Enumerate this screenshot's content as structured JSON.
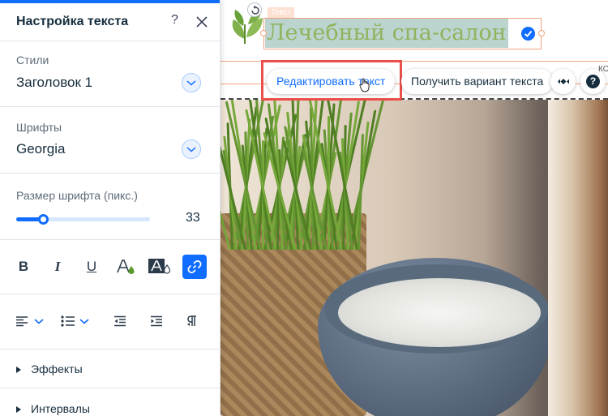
{
  "panel": {
    "title": "Настройка текста",
    "help_label": "?",
    "styles_label": "Стили",
    "styles_value": "Заголовок 1",
    "fonts_label": "Шрифты",
    "fonts_value": "Georgia",
    "size_label": "Размер шрифта (пикс.)",
    "size_value": "33",
    "size_slider_fraction": 0.2,
    "format_buttons": [
      "B",
      "I",
      "U"
    ],
    "effects_label": "Эффекты",
    "spacing_label": "Интервалы"
  },
  "editor": {
    "tag_label": "Текст",
    "heading_text": "Лечебный спа-салон",
    "edit_button_label": "Редактировать текст",
    "variant_button_label": "Получить вариант текста",
    "help_round_label": "?",
    "cut_text": "КО"
  },
  "colors": {
    "accent": "#116dff",
    "heading_green": "#8fb35d",
    "selection_orange": "#f1a582",
    "highlight_red": "#ea4f4a"
  }
}
